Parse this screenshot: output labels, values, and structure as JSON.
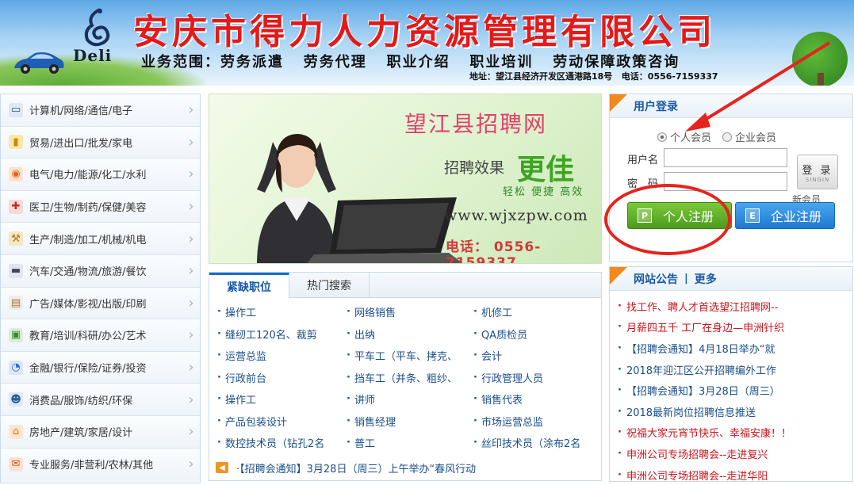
{
  "header": {
    "logo_text": "Deli",
    "company_name": "安庆市得力人力资源管理有限公司",
    "business_scope": "业务范围：劳务派遣   劳务代理   职业介绍   职业培训   劳动保障政策咨询",
    "address": "地址：望江县经济开发区通港路18号   电话：0556-7159337"
  },
  "sidebar": {
    "items": [
      {
        "label": "计算机/网络/通信/电子",
        "icon": "computer-icon"
      },
      {
        "label": "贸易/进出口/批发/家电",
        "icon": "coins-icon"
      },
      {
        "label": "电气/电力/能源/化工/水利",
        "icon": "energy-icon"
      },
      {
        "label": "医卫/生物/制药/保健/美容",
        "icon": "medical-icon"
      },
      {
        "label": "生产/制造/加工/机械/机电",
        "icon": "hammer-icon"
      },
      {
        "label": "汽车/交通/物流/旅游/餐饮",
        "icon": "truck-icon"
      },
      {
        "label": "广告/媒体/影视/出版/印刷",
        "icon": "document-icon"
      },
      {
        "label": "教育/培训/科研/办公/艺术",
        "icon": "picture-icon"
      },
      {
        "label": "金融/银行/保险/证券/投资",
        "icon": "pie-chart-icon"
      },
      {
        "label": "消费品/服饰/纺织/环保",
        "icon": "person-icon"
      },
      {
        "label": "房地产/建筑/家居/设计",
        "icon": "house-icon"
      },
      {
        "label": "专业服务/非营利/农林/其他",
        "icon": "chat-icon"
      }
    ]
  },
  "slide": {
    "title": "望江县招聘网",
    "effect": "招聘效果",
    "better": "更佳",
    "words": "轻松 便捷 高效",
    "url": "www.wjxzpw.com",
    "phone": "电话： 0556-7159337"
  },
  "jobs": {
    "tabs": [
      "紧缺职位",
      "热门搜索"
    ],
    "items": [
      "操作工",
      "网络销售",
      "机修工",
      "缝纫工120名、裁剪",
      "出纳",
      "QA质检员",
      "运营总监",
      "平车工（平车、拷克、",
      "会计",
      "行政前台",
      "挡车工（并条、粗纱、",
      "行政管理人员",
      "操作工",
      "讲师",
      "销售代表",
      "产品包装设计",
      "销售经理",
      "市场运营总监",
      "数控技术员（钻孔2名",
      "普工",
      "丝印技术员（涂布2名"
    ],
    "ticker": "·【招聘会通知】3月28日（周三）上午举办“春风行动"
  },
  "login": {
    "title": "用户登录",
    "radio_personal": "个人会员",
    "radio_company": "企业会员",
    "username_label": "用户名",
    "password_label": "密　码",
    "login_button": "登 录",
    "login_button_sub": "SINGIN",
    "new_member": "新会员",
    "register_personal": "个人注册",
    "register_company": "企业注册",
    "badge_p": "P",
    "badge_e": "E"
  },
  "notice": {
    "title": "网站公告",
    "sep": "|",
    "more": "更多",
    "items": [
      {
        "text": "找工作、聘人才首选望江招聘网--",
        "color": "#c8161d"
      },
      {
        "text": "月薪四五千 工厂在身边—申洲针织",
        "color": "#c8161d"
      },
      {
        "text": "【招聘会通知】4月18日举办“就",
        "color": "#1a4f8a"
      },
      {
        "text": "2018年迎江区公开招聘编外工作",
        "color": "#1a4f8a"
      },
      {
        "text": "【招聘会通知】3月28日（周三）",
        "color": "#1a4f8a"
      },
      {
        "text": "2018最新岗位招聘信息推送",
        "color": "#1a4f8a"
      },
      {
        "text": "祝福大家元宵节快乐、幸福安康！！",
        "color": "#c8161d"
      },
      {
        "text": "申洲公司专场招聘会--走进复兴",
        "color": "#c8161d"
      },
      {
        "text": "申洲公司专场招聘会--走进华阳",
        "color": "#c8161d"
      }
    ]
  },
  "colors": {
    "brand_red": "#e41919",
    "link_blue": "#1a4f8a",
    "accent_orange": "#f08a1c",
    "annotation_red": "#e6231c"
  }
}
